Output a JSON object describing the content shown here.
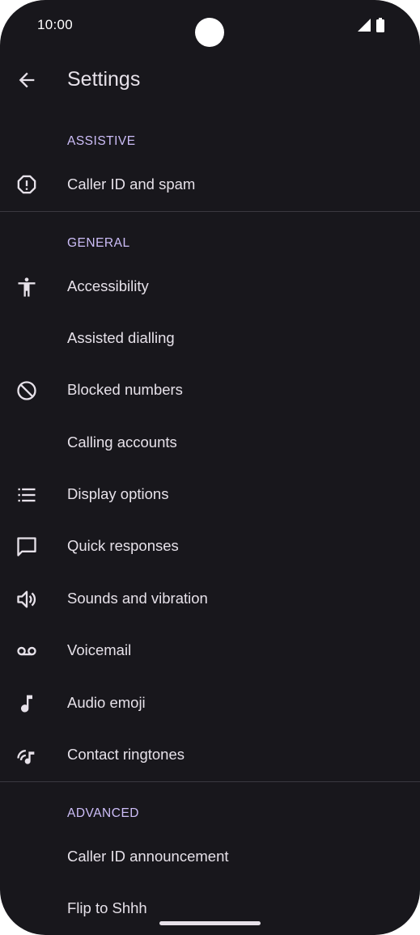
{
  "status_bar": {
    "time": "10:00",
    "signal_icon": "signal-icon",
    "battery_icon": "battery-icon"
  },
  "header": {
    "title": "Settings",
    "back_icon": "back-arrow-icon"
  },
  "sections": {
    "assistive": "ASSISTIVE",
    "general": "GENERAL",
    "advanced": "ADVANCED"
  },
  "items": {
    "caller_id": {
      "label": "Caller ID and spam",
      "icon": "alert-octagon-icon"
    },
    "accessibility": {
      "label": "Accessibility",
      "icon": "accessibility-icon"
    },
    "assisted_dialling": {
      "label": "Assisted dialling"
    },
    "blocked_numbers": {
      "label": "Blocked numbers",
      "icon": "block-icon"
    },
    "calling_accounts": {
      "label": "Calling accounts"
    },
    "display_options": {
      "label": "Display options",
      "icon": "list-icon"
    },
    "quick_responses": {
      "label": "Quick responses",
      "icon": "message-icon"
    },
    "sounds_vibration": {
      "label": "Sounds and vibration",
      "icon": "volume-icon"
    },
    "voicemail": {
      "label": "Voicemail",
      "icon": "voicemail-icon"
    },
    "audio_emoji": {
      "label": "Audio emoji",
      "icon": "music-note-icon"
    },
    "contact_ringtones": {
      "label": "Contact ringtones",
      "icon": "ringtone-icon"
    },
    "caller_id_announcement": {
      "label": "Caller ID announcement"
    },
    "flip_to_shhh": {
      "label": "Flip to Shhh"
    }
  },
  "colors": {
    "background": "#18171c",
    "text": "#e6e1e9",
    "section": "#cdbef8",
    "divider": "#3a3840"
  }
}
